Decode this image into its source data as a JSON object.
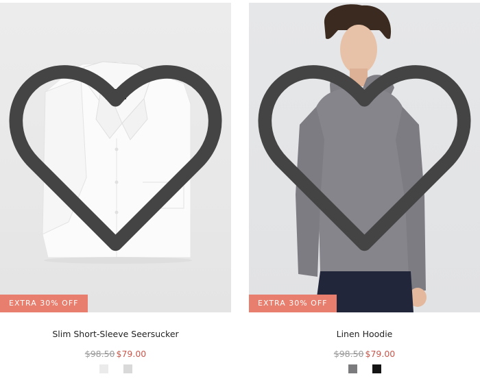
{
  "products": [
    {
      "name": "Slim Short-Sleeve Seersucker",
      "badge": "EXTRA 30% OFF",
      "original_price": "$98.50",
      "sale_price": "$79.00",
      "swatches": [
        "#ebebeb",
        "#d9d9d9"
      ],
      "image_alt": "white short-sleeve shirt"
    },
    {
      "name": "Linen Hoodie",
      "badge": "EXTRA 30% OFF",
      "original_price": "$98.50",
      "sale_price": "$79.00",
      "swatches": [
        "#7b7a7d",
        "#141414"
      ],
      "image_alt": "grey linen hoodie"
    }
  ],
  "colors": {
    "badge_bg": "#e87e6e",
    "sale_price": "#c9574b",
    "original_price": "#9a9a9a"
  },
  "icons": {
    "wishlist": "heart-outline-icon"
  }
}
